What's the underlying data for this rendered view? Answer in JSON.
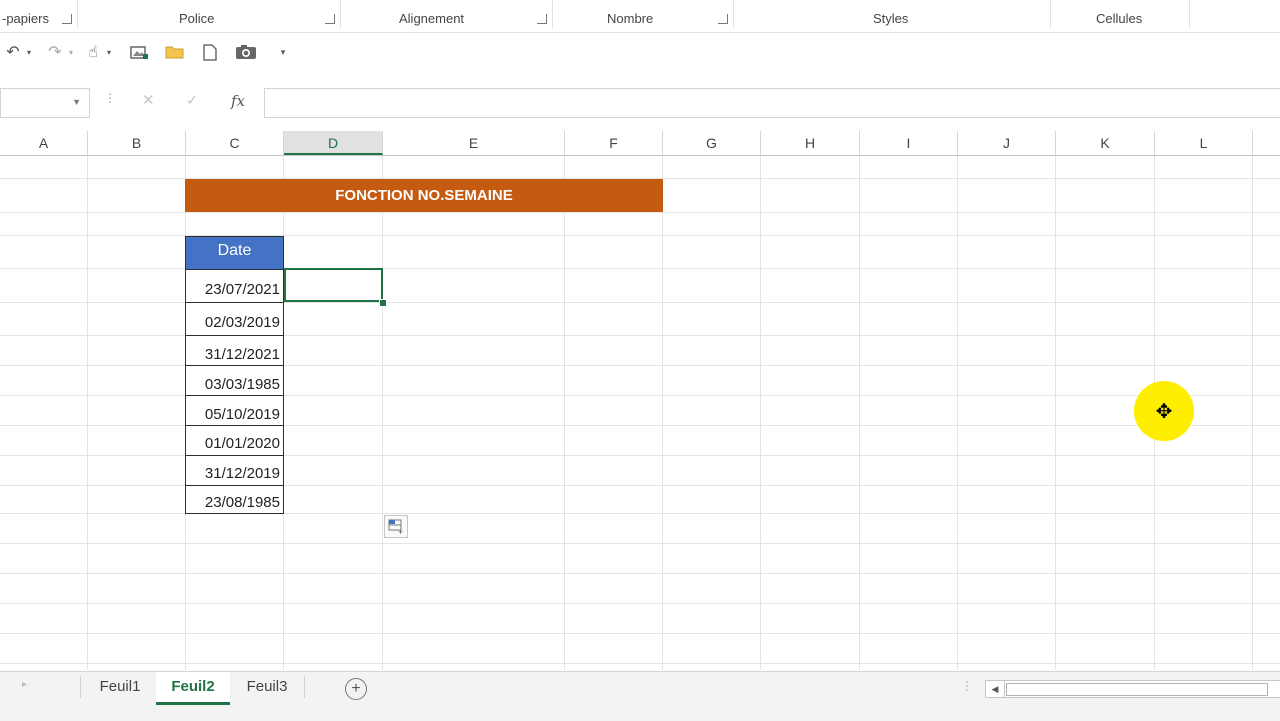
{
  "ribbon": {
    "groups": [
      {
        "label": "-papiers"
      },
      {
        "label": "Police"
      },
      {
        "label": "Alignement"
      },
      {
        "label": "Nombre"
      },
      {
        "label": "Styles"
      },
      {
        "label": "Cellules"
      }
    ]
  },
  "qat": {
    "icons": [
      "undo-icon",
      "redo-icon",
      "touch-mode-icon",
      "insert-picture-icon",
      "open-folder-icon",
      "new-document-icon",
      "camera-icon",
      "customize-qat-icon"
    ]
  },
  "formula_bar": {
    "name_box_value": "",
    "formula_value": "",
    "cancel_glyph": "✕",
    "enter_glyph": "✓",
    "fx_label": "fx"
  },
  "columns": [
    "A",
    "B",
    "C",
    "D",
    "E",
    "F",
    "G",
    "H",
    "I",
    "J",
    "K",
    "L"
  ],
  "selected_column": "D",
  "sheet": {
    "title": "FONCTION NO.SEMAINE",
    "header": "Date",
    "dates": [
      "23/07/2021",
      "02/03/2019",
      "31/12/2021",
      "03/03/1985",
      "05/10/2019",
      "01/01/2020",
      "31/12/2019",
      "23/08/1985"
    ]
  },
  "tabs": {
    "items": [
      "Feuil1",
      "Feuil2",
      "Feuil3"
    ],
    "active": "Feuil2",
    "add_glyph": "+"
  },
  "colors": {
    "title_fill": "#c55a11",
    "header_fill": "#4472c4",
    "excel_green": "#217346",
    "cursor_highlight": "#ffee00"
  }
}
